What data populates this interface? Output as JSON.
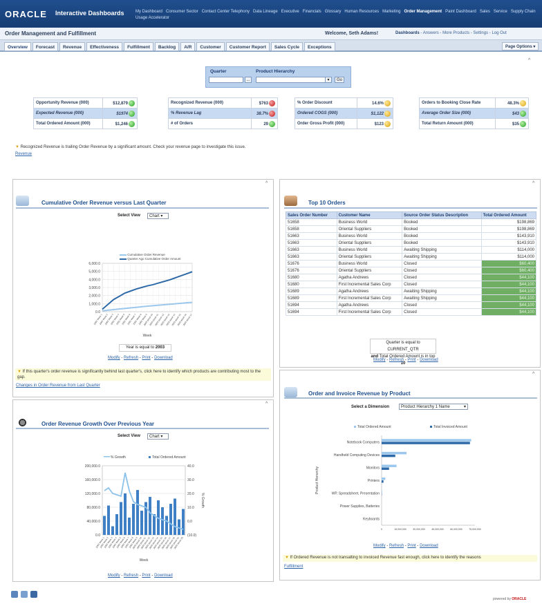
{
  "app": {
    "brand": "ORACLE",
    "name": "Interactive Dashboards"
  },
  "top_nav": [
    "My Dashboard",
    "Consumer Sector",
    "Contact Center Telephony",
    "Data Lineage",
    "Executive",
    "Financials",
    "Glossary",
    "Human Resources",
    "Marketing",
    "Order Management",
    "Paint Dashboard",
    "Sales",
    "Service",
    "Supply Chain",
    "Usage Accelerator"
  ],
  "top_nav_active": "Order Management",
  "page": {
    "title": "Order Management and Fulfillment",
    "welcome": "Welcome, Seth Adams!",
    "right_links": [
      "Dashboards",
      "Answers",
      "More Products",
      "Settings",
      "Log Out"
    ],
    "page_options": "Page Options"
  },
  "tabs": [
    "Overview",
    "Forecast",
    "Revenue",
    "Effectiveness",
    "Fulfillment",
    "Backlog",
    "A/R",
    "Customer",
    "Customer Report",
    "Sales Cycle",
    "Exceptions"
  ],
  "active_tab": "Overview",
  "prompt": {
    "quarter_label": "Quarter",
    "hierarchy_label": "Product Hierarchy",
    "browse": "...",
    "go": "Go"
  },
  "kpis": [
    [
      {
        "label": "Opportunity Revenue (000)",
        "value": "$12,879",
        "status": "green"
      },
      {
        "label": "Expected Revenue (000)",
        "value": "$1974",
        "status": "green"
      },
      {
        "label": "Total Ordered Amount (000)",
        "value": "$1,246",
        "status": "green"
      }
    ],
    [
      {
        "label": "Recognized Revenue (000)",
        "value": "$763",
        "status": "red"
      },
      {
        "label": "% Revenue Lag",
        "value": "38.7%",
        "status": "red"
      },
      {
        "label": "# of Orders",
        "value": "29",
        "status": "green"
      }
    ],
    [
      {
        "label": "% Order Discount",
        "value": "14.6%",
        "status": "yellow"
      },
      {
        "label": "Ordered COGS (000)",
        "value": "$1,122",
        "status": "yellow"
      },
      {
        "label": "Order Gross Profit (000)",
        "value": "$123",
        "status": "yellow"
      }
    ],
    [
      {
        "label": "Orders to Booking Close Rate",
        "value": "48.3%",
        "status": "yellow"
      },
      {
        "label": "Average Order Size (000)",
        "value": "$43",
        "status": "green"
      },
      {
        "label": "Total Return Amount (000)",
        "value": "$35",
        "status": "green"
      }
    ]
  ],
  "status_colors": {
    "green": "#21a021",
    "red": "#c41414",
    "yellow": "#d9a30c"
  },
  "alert": {
    "text": "Recognized Revenue is trailing Order Revenue by a significant amount. Check your revenue page to investigate this issue.",
    "link": "Revenue"
  },
  "cumulative": {
    "title": "Cumulative Order Revenue versus Last Quarter",
    "select_label": "Select View",
    "select_value": "Chart",
    "filter_prefix": "Year is equal to",
    "filter_value": "2003",
    "actions": [
      "Modify",
      "Refresh",
      "Print",
      "Download"
    ],
    "note": "If this quarter's order revenue is significantly behind last quarter's, click here to identify which products are contributing most to the gap.",
    "note_link": "Changes in Order Revenue from Last Quarter"
  },
  "growth": {
    "title": "Order Revenue Growth Over Previous Year",
    "select_label": "Select View",
    "select_value": "Chart",
    "actions": [
      "Modify",
      "Refresh",
      "Print",
      "Download"
    ]
  },
  "top10": {
    "title": "Top 10 Orders",
    "columns": [
      "Sales Order Number",
      "Customer Name",
      "Source Order Status Description",
      "Total Ordered Amount"
    ],
    "rows": [
      [
        "51658",
        "Business World",
        "Booked",
        "$198,869"
      ],
      [
        "51658",
        "Oriental Suppliers",
        "Booked",
        "$198,869"
      ],
      [
        "51663",
        "Business World",
        "Booked",
        "$143,910"
      ],
      [
        "51663",
        "Oriental Suppliers",
        "Booked",
        "$143,910"
      ],
      [
        "51663",
        "Business World",
        "Awaiting Shipping",
        "$114,000"
      ],
      [
        "51663",
        "Oriental Suppliers",
        "Awaiting Shipping",
        "$114,000"
      ],
      [
        "51676",
        "Business World",
        "Closed",
        "$60,400"
      ],
      [
        "51676",
        "Oriental Suppliers",
        "Closed",
        "$60,400"
      ],
      [
        "51680",
        "Agatha Andrews",
        "Closed",
        "$44,100"
      ],
      [
        "51680",
        "First Incremental Sales Corp",
        "Closed",
        "$44,100"
      ],
      [
        "51689",
        "Agatha Andrews",
        "Awaiting Shipping",
        "$44,100"
      ],
      [
        "51689",
        "First Incremental Sales Corp",
        "Awaiting Shipping",
        "$44,100"
      ],
      [
        "51694",
        "Agatha Andrews",
        "Closed",
        "$44,100"
      ],
      [
        "51694",
        "First Incremental Sales Corp",
        "Closed",
        "$44,100"
      ]
    ],
    "filter_line1": "Quarter is equal to CURRENT_QTR",
    "filter_line2_a": "and",
    "filter_line2_b": "Total Ordered Amount is in top",
    "filter_line2_c": "10",
    "actions": [
      "Modify",
      "Refresh",
      "Print",
      "Download"
    ]
  },
  "invoice": {
    "title": "Order and Invoice Revenue by Product",
    "select_label": "Select a Dimension",
    "select_value": "Product Hierarchy 1 Name",
    "actions": [
      "Modify",
      "Refresh",
      "Print",
      "Download"
    ],
    "note": "If Ordered Revenue is not transalting to invoiced Revenue fast enough, click here to identify the reasons",
    "note_link": "Fulfillment"
  },
  "chart_data": [
    {
      "type": "line",
      "legend": [
        "Cumulative Order Revenue",
        "Quarter Ago Cumulative Order Amount"
      ],
      "xlabel": "Week",
      "ylim": [
        0,
        6000
      ],
      "y_ticks": [
        "0.0",
        "1,000.0",
        "2,000.0",
        "3,000.0",
        "4,000.0",
        "5,000.0",
        "6,000.0"
      ],
      "series": [
        {
          "name": "Cumulative Order Revenue",
          "color": "#9cc7ec",
          "values": [
            100,
            180,
            260,
            330,
            400,
            470,
            540,
            610,
            680,
            740,
            800,
            860,
            920,
            980,
            1040,
            1100,
            1160
          ]
        },
        {
          "name": "Quarter Ago Cumulative Order Amount",
          "color": "#2f6aa8",
          "values": [
            300,
            900,
            1500,
            1900,
            2300,
            2550,
            2800,
            3000,
            3200,
            3350,
            3550,
            3750,
            3950,
            4200,
            4450,
            4700,
            4950
          ]
        }
      ]
    },
    {
      "type": "bar",
      "legend": [
        "% Growth",
        "Total Ordered Amount"
      ],
      "xlabel": "Week",
      "y_ticks_left": [
        "0.0",
        "40,000.0",
        "80,000.0",
        "120,000.0",
        "160,000.0",
        "200,000.0"
      ],
      "y_ticks_right": [
        "(10.0)",
        "0.0",
        "10.0",
        "20.0",
        "30.0",
        "40.0"
      ],
      "ylabel_right": "% Growth",
      "ylim_left": [
        0,
        200000
      ],
      "ylim_right": [
        -10,
        40
      ],
      "series": [
        {
          "name": "Total Ordered Amount",
          "color": "#3f7fc6",
          "values": [
            55000,
            85000,
            25000,
            60000,
            95000,
            120000,
            50000,
            90000,
            130000,
            70000,
            95000,
            110000,
            60000,
            100000,
            80000,
            55000,
            90000,
            105000,
            45000,
            75000
          ]
        },
        {
          "name": "% Growth",
          "color": "#8cc2ea",
          "values": [
            22,
            24,
            20,
            19,
            18,
            35,
            22,
            14,
            12,
            11,
            10,
            6,
            4,
            2,
            1,
            0,
            -2,
            -4,
            -5,
            -6
          ]
        }
      ]
    },
    {
      "type": "bar",
      "orientation": "horizontal",
      "legend": [
        "Total Ordered Amount",
        "Total Invoiced Amount"
      ],
      "ylabel": "Product Hierarchy",
      "categories": [
        "Notebook Computers",
        "Handheld Computing Devices",
        "Monitors",
        "Printers",
        "WP, Spreadsheet, Presentation",
        "Power Supplies, Batteries",
        "Keyboards"
      ],
      "x_ticks": [
        "0",
        "15,000,000",
        "30,000,000",
        "45,000,000",
        "60,000,000",
        "75,000,000"
      ],
      "xlim": [
        0,
        75000000
      ],
      "series": [
        {
          "name": "Total Ordered Amount",
          "color": "#9cc7ec",
          "values": [
            72000000,
            20000000,
            12000000,
            3000000,
            400000,
            0,
            0
          ]
        },
        {
          "name": "Total Invoiced Amount",
          "color": "#2f6aa8",
          "values": [
            71000000,
            11000000,
            6000000,
            1500000,
            200000,
            0,
            0
          ]
        }
      ]
    }
  ],
  "footer": {
    "powered_by": "powered by",
    "powered_brand": "ORACLE"
  }
}
